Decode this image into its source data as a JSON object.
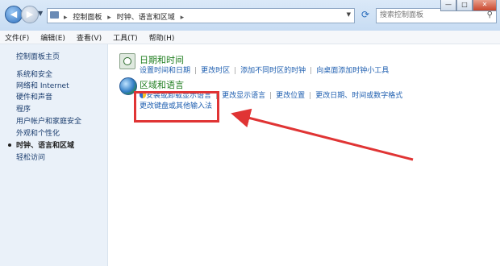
{
  "window": {
    "controls": {
      "minimize": "—",
      "maximize": "□",
      "close": "✕"
    }
  },
  "address": {
    "crumbs": [
      "控制面板",
      "时钟、语言和区域"
    ],
    "separator": "▸"
  },
  "search": {
    "placeholder": "搜索控制面板"
  },
  "menubar": {
    "items": [
      "文件(F)",
      "编辑(E)",
      "查看(V)",
      "工具(T)",
      "帮助(H)"
    ]
  },
  "sidebar": {
    "home": "控制面板主页",
    "items": [
      "系统和安全",
      "网络和 Internet",
      "硬件和声音",
      "程序",
      "用户帐户和家庭安全",
      "外观和个性化",
      "时钟、语言和区域",
      "轻松访问"
    ]
  },
  "main": {
    "datetime": {
      "title": "日期和时间",
      "links": [
        "设置时间和日期",
        "更改时区",
        "添加不同时区的时钟",
        "向桌面添加时钟小工具"
      ]
    },
    "region": {
      "title": "区域和语言",
      "links": [
        "安装或卸载显示语言",
        "更改显示语言",
        "更改位置",
        "更改日期、时间或数字格式"
      ],
      "link2": "更改键盘或其他输入法"
    }
  },
  "colors": {
    "annotation": "#e03434",
    "link": "#1f5fb0",
    "category": "#1e7d1e"
  }
}
